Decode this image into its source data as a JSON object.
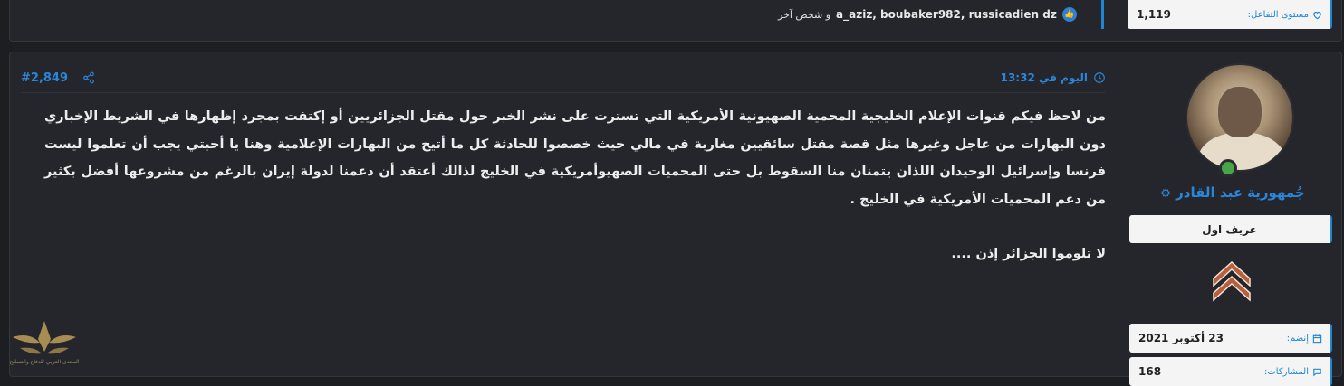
{
  "prev_post": {
    "reactions": {
      "names": "a_aziz, boubaker982, russicadien dz",
      "others": "و شخص آخر"
    },
    "stat": {
      "label": "مستوى التفاعل:",
      "value": "1,119"
    }
  },
  "post": {
    "number": "#2,849",
    "date": "اليوم في 13:32",
    "body": [
      "من لاحظ فيكم قنوات الإعلام الخليجية المحمية الصهيونية الأمريكية التي تسترت على نشر الخبر حول مقتل الجزائريين أو إكتفت بمجرد إظهارها في الشريط الإخباري دون البهارات من عاجل وغيرها مثل قصة مقتل سائقيين مغاربة في مالي حيث خصصوا للحادثة كل ما أتيح من البهارات الإعلامية وهنا يا أحبتي يجب أن تعلموا ليست فرنسا وإسرائيل الوحيدان اللذان يتمنان منا السقوط بل حتى المحميات الصهيوأمريكية في الخليج لذالك أعتقد أن دعمنا لدولة إيران بالرغم من مشروعها أفضل بكثير من دعم المحميات الأمريكية في الخليج ."
    ],
    "closing": "لا تلوموا الجزائر إذن ...."
  },
  "user": {
    "name": "جُمهورية عبد القادر",
    "title": "عريف اول",
    "joined_label": "إنضم:",
    "joined_value": "23 أكتوبر 2021",
    "views_label": "المشاركات:",
    "views_value": "168"
  },
  "watermark": {
    "text": "المنتدى العربي للدفاع والتسليح"
  },
  "colors": {
    "accent": "#1f86d6",
    "background": "#1d1e22",
    "panel": "#24262b",
    "online": "#48a548"
  },
  "icons": [
    "heart-icon",
    "like-icon",
    "share-icon",
    "clock-icon",
    "online-status-icon",
    "rank-chevron-icon",
    "calendar-icon",
    "comments-icon"
  ]
}
